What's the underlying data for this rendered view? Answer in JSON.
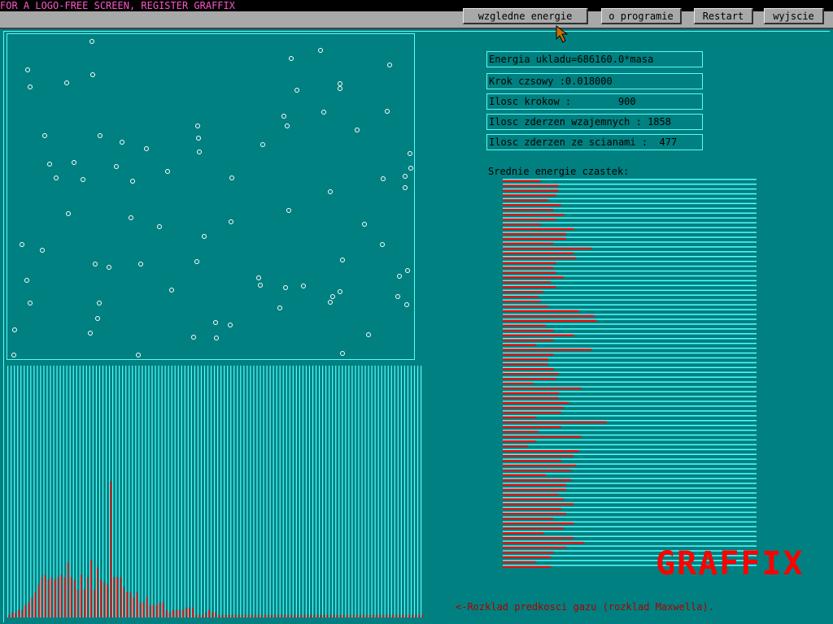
{
  "banner": "FOR A LOGO-FREE SCREEN, REGISTER GRAFFIX",
  "menu": [
    {
      "label": "wzgledne energie"
    },
    {
      "label": "o programie"
    },
    {
      "label": "Restart"
    },
    {
      "label": "wyjscie"
    }
  ],
  "stats": {
    "energia": "Energia ukladu=686160.0*masa",
    "krok": "Krok czsowy :0.018000",
    "ilosc_krokow": "Ilosc krokow :        900",
    "zderzenia_wzajemne": "Ilosc zderzen wzajemnych : 1858",
    "zderzenia_sciany": "Ilosc zderzen ze scianami :  477"
  },
  "energy_title": "Srednie energie czastek:",
  "logo": "GRAFFIX",
  "caption": "<-Rozklad predkosci gazu (rozklad Maxwella).",
  "colors": {
    "background": "#008080",
    "bar_red": "#ff0000",
    "line_cyan": "#55ffff",
    "particle": "#ffffff"
  },
  "particles": {
    "count": 83
  },
  "chart_data": [
    {
      "type": "bar",
      "title": "Srednie energie czastek:",
      "orientation": "horizontal",
      "values": [
        0.15,
        0.22,
        0.22,
        0.21,
        0.18,
        0.23,
        0.2,
        0.24,
        0.21,
        0.15,
        0.28,
        0.25,
        0.25,
        0.2,
        0.35,
        0.28,
        0.29,
        0.21,
        0.2,
        0.21,
        0.24,
        0.19,
        0.21,
        0.16,
        0.14,
        0.15,
        0.18,
        0.3,
        0.36,
        0.37,
        0.17,
        0.2,
        0.28,
        0.2,
        0.13,
        0.35,
        0.2,
        0.18,
        0.18,
        0.2,
        0.22,
        0.21,
        0.12,
        0.31,
        0.22,
        0.22,
        0.26,
        0.24,
        0.23,
        0.13,
        0.41,
        0.23,
        0.14,
        0.31,
        0.13,
        0.1,
        0.3,
        0.28,
        0.23,
        0.29,
        0.27,
        0.17,
        0.27,
        0.25,
        0.25,
        0.22,
        0.24,
        0.28,
        0.23,
        0.25,
        0.2,
        0.28,
        0.24,
        0.16,
        0.28,
        0.32,
        0.25,
        0.2,
        0.19,
        0.13,
        0.19
      ],
      "xlim": [
        0,
        1
      ]
    },
    {
      "type": "bar",
      "caption": "<-Rozklad predkosci gazu (rozklad Maxwella).",
      "values": [
        1,
        2,
        2,
        3,
        3,
        5,
        6,
        8,
        10,
        13,
        16,
        17,
        15,
        16,
        15,
        16,
        17,
        16,
        22,
        16,
        15,
        11,
        17,
        11,
        16,
        23,
        11,
        20,
        15,
        14,
        13,
        54,
        16,
        16,
        16,
        12,
        10,
        10,
        8,
        10,
        6,
        6,
        8,
        5,
        5,
        5,
        6,
        6,
        3,
        2,
        3,
        3,
        3,
        3,
        4,
        4,
        4,
        1,
        1,
        1,
        2,
        3,
        2,
        2,
        1,
        1,
        1,
        1,
        1,
        1,
        1,
        1,
        1,
        1,
        1,
        1,
        1,
        1,
        1,
        1,
        1,
        1,
        1,
        1,
        1,
        1,
        1,
        1,
        1,
        1,
        1,
        1,
        1,
        1,
        1,
        1,
        1,
        1,
        1,
        1,
        1,
        1,
        1,
        1,
        1,
        1,
        1,
        1,
        1,
        1,
        1,
        1,
        1,
        1,
        1,
        1,
        1,
        1,
        1,
        1,
        1,
        1,
        1,
        1,
        1,
        1,
        1
      ],
      "ylim": [
        0,
        100
      ]
    }
  ]
}
